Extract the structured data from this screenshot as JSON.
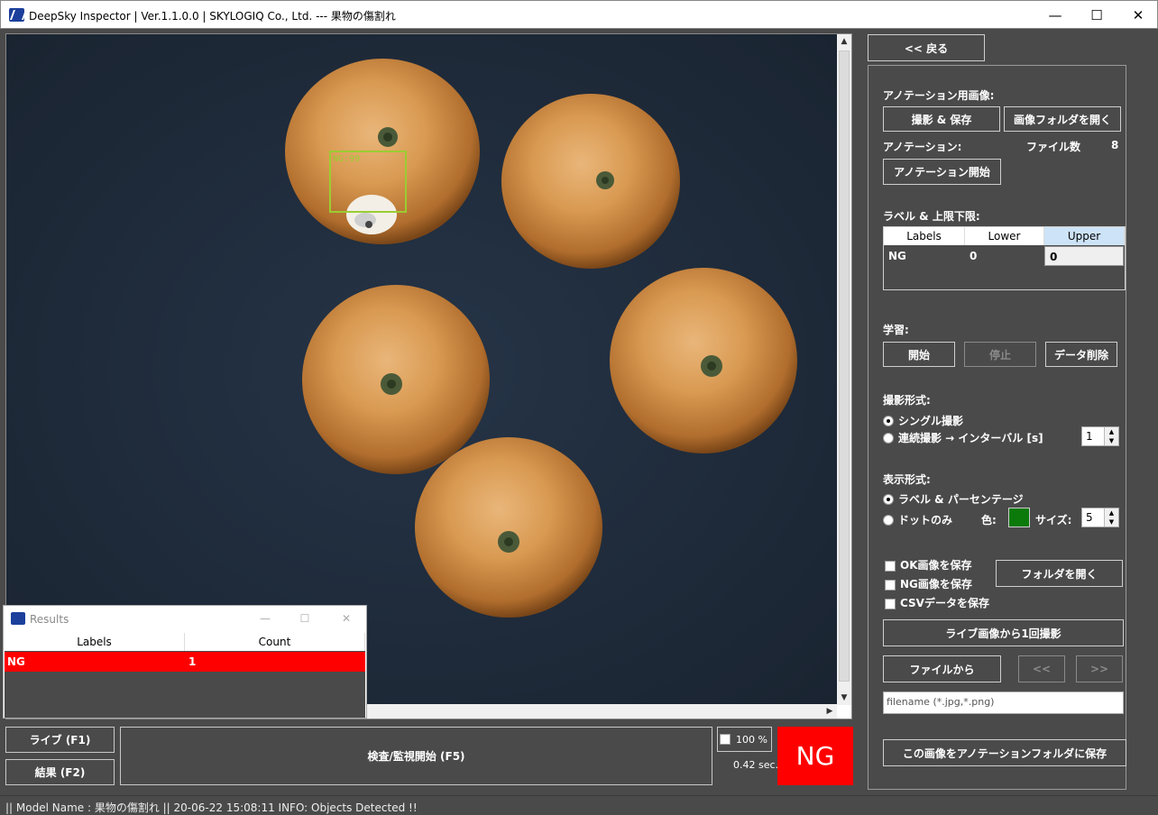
{
  "window": {
    "title": "DeepSky Inspector | Ver.1.1.0.0 | SKYLOGIQ Co., Ltd. --- 果物の傷割れ",
    "minimize": "—",
    "maximize": "☐",
    "close": "✕"
  },
  "viewer": {
    "detection_label": "NG:99",
    "detection_color": "#9acd32"
  },
  "bottom": {
    "live_button": "ライブ (F1)",
    "result_button": "結果 (F2)",
    "inspect_button": "検査/監視開始 (F5)",
    "zoom_label": "100 %",
    "time_label": "0.42 sec.",
    "verdict": "NG",
    "verdict_color": "#ff0000"
  },
  "status": {
    "text": "|| Model Name : 果物の傷割れ ||    20-06-22 15:08:11    INFO:   Objects Detected !!"
  },
  "panel": {
    "back_button": "<< 戻る",
    "annotation_images_label": "アノテーション用画像:",
    "capture_save_button": "撮影 & 保存",
    "open_image_folder_button": "画像フォルダを開く",
    "annotation_label": "アノテーション:",
    "file_count_label": "ファイル数",
    "file_count_value": "8",
    "start_annotation_button": "アノテーション開始",
    "label_limits_label": "ラベル & 上限下限:",
    "table": {
      "headers": [
        "Labels",
        "Lower",
        "Upper"
      ],
      "rows": [
        [
          "NG",
          "0",
          "0"
        ]
      ]
    },
    "learning_label": "学習:",
    "learn_start_button": "開始",
    "learn_stop_button": "停止",
    "delete_data_button": "データ削除",
    "capture_mode_label": "撮影形式:",
    "single_capture": "シングル撮影",
    "continuous_capture": "連続撮影 → インターバル [s]",
    "interval_value": "1",
    "display_mode_label": "表示形式:",
    "label_percentage": "ラベル & パーセンテージ",
    "dots_only": "ドットのみ",
    "color_label": "色:",
    "dot_color": "#0b7a0b",
    "size_label": "サイズ:",
    "size_value": "5",
    "save_ok": "OK画像を保存",
    "save_ng": "NG画像を保存",
    "save_csv": "CSVデータを保存",
    "open_folder_button": "フォルダを開く",
    "capture_once_button": "ライブ画像から1回撮影",
    "from_file_button": "ファイルから",
    "prev_button": "<<",
    "next_button": ">>",
    "filename_placeholder": "filename (*.jpg,*.png)",
    "save_to_annotation_button": "この画像をアノテーションフォルダに保存"
  },
  "results": {
    "title": "Results",
    "headers": [
      "Labels",
      "Count"
    ],
    "rows": [
      [
        "NG",
        "1"
      ]
    ]
  }
}
